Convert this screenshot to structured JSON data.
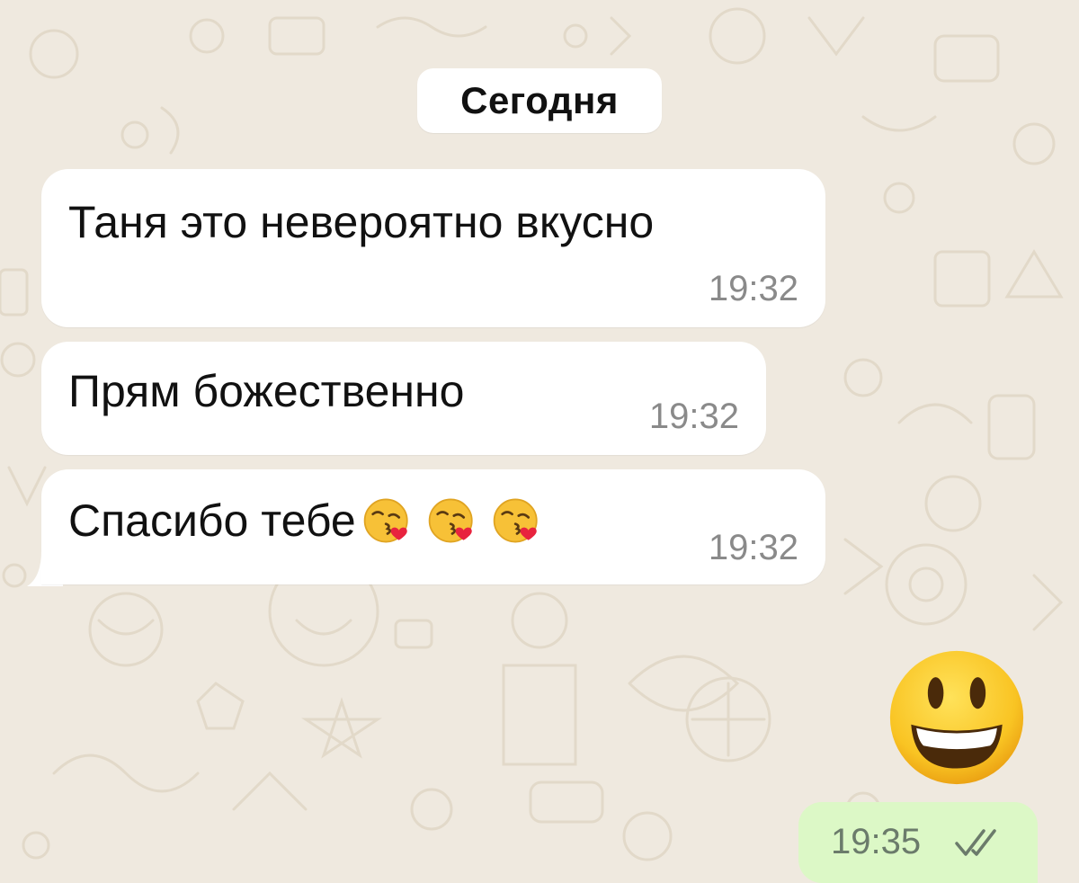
{
  "date_divider": "Сегодня",
  "messages": [
    {
      "text": "Таня это невероятно вкусно",
      "time": "19:32"
    },
    {
      "text": "Прям божественно",
      "time": "19:32"
    },
    {
      "text": "Спасибо тебе",
      "time": "19:32",
      "emojis": [
        "face-blowing-kiss-icon",
        "face-blowing-kiss-icon",
        "face-blowing-kiss-icon"
      ]
    }
  ],
  "outgoing": {
    "emoji": "grinning-face-big-eyes-icon",
    "time": "19:35",
    "status": "double-check-icon"
  },
  "colors": {
    "wallpaper": "#efe9df",
    "incoming_bubble": "#ffffff",
    "outgoing_bubble": "#dcf8c6",
    "timestamp": "#8a8a8a"
  }
}
